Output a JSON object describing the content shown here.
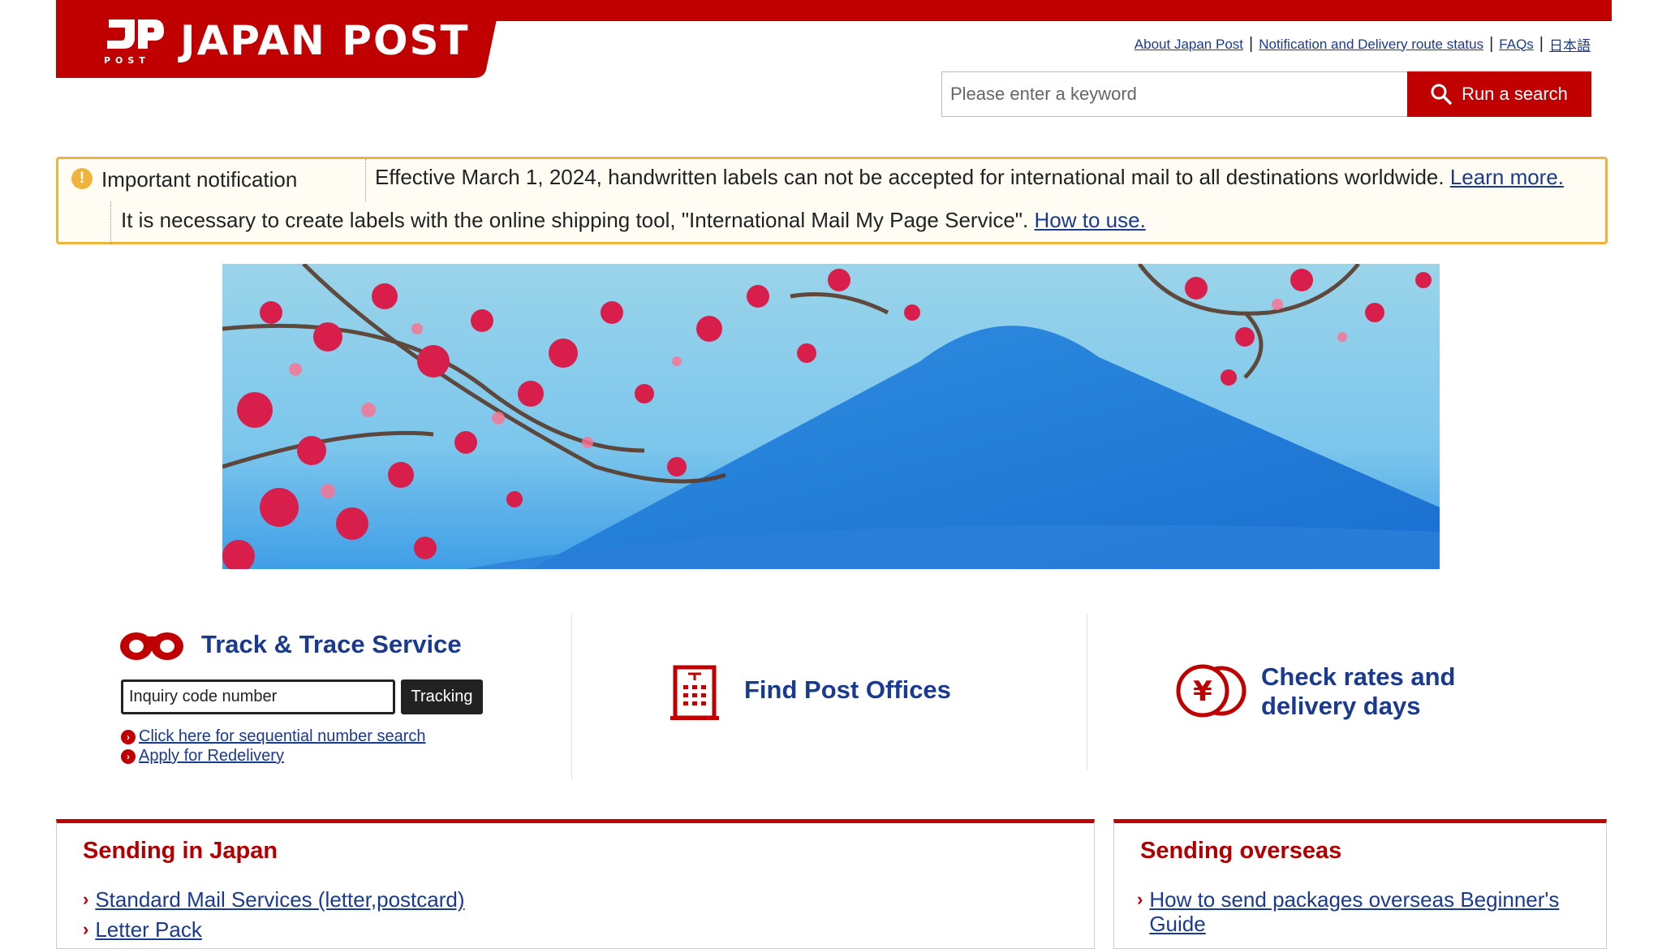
{
  "header": {
    "logo_text": "JAPAN POST",
    "logo_subtext": "POST",
    "links": [
      "About Japan Post",
      "Notification and Delivery route status",
      "FAQs",
      "日本語"
    ],
    "search": {
      "placeholder": "Please enter a keyword",
      "button_label": "Run a search"
    },
    "brand_color": "#c00000"
  },
  "notice": {
    "label": "Important notification",
    "line1_text": "Effective March 1, 2024, handwritten labels can not be accepted for international mail to all destinations worldwide.",
    "line1_link": "Learn more.",
    "line2_text": "It is necessary to create labels with the online shipping tool, \"International Mail My Page Service\".",
    "line2_link": "How to use."
  },
  "track": {
    "title": "Track & Trace Service",
    "input_value": "Inquiry code number",
    "button_label": "Tracking",
    "links": [
      "Click here for sequential number search",
      "Apply for Redelivery"
    ]
  },
  "find_post_offices": {
    "title": "Find Post Offices"
  },
  "rates": {
    "title_line1": "Check rates and",
    "title_line2": "delivery days"
  },
  "sending_japan": {
    "title": "Sending in Japan",
    "links": [
      "Standard Mail Services (letter,postcard)",
      "Letter Pack"
    ]
  },
  "sending_overseas": {
    "title": "Sending overseas",
    "links": [
      "How to send packages overseas Beginner's Guide"
    ]
  },
  "icons": [
    "search-icon",
    "exclamation-icon",
    "binoculars-icon",
    "post-office-building-icon",
    "yen-coins-icon",
    "chevron-right-icon"
  ]
}
